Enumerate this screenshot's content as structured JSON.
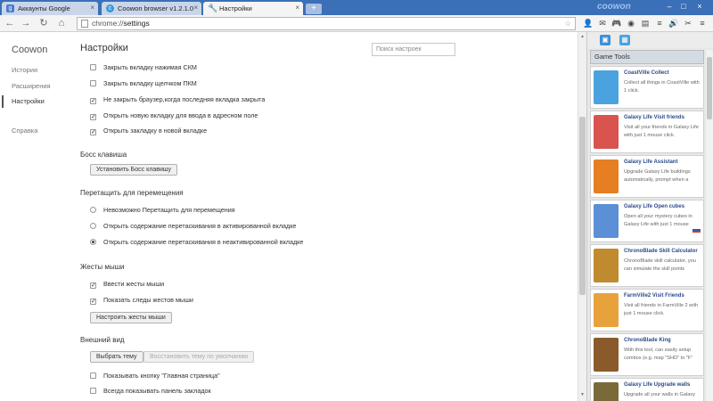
{
  "tabs": [
    {
      "label": "Аккаунты Google",
      "icon": "google-icon",
      "color": "#4a7bd0"
    },
    {
      "label": "Coowon browser v1.2.1.0",
      "icon": "coowon-icon",
      "color": "#3a9ad9"
    },
    {
      "label": "Настройки",
      "icon": "wrench-icon",
      "color": "#888888"
    }
  ],
  "brand": "coowon",
  "address": {
    "prefix": "chrome://",
    "path": "settings"
  },
  "leftnav": {
    "title": "Coowon",
    "items": [
      "История",
      "Расширения",
      "Настройки",
      "Справка"
    ],
    "selected": "Настройки"
  },
  "main": {
    "title": "Настройки",
    "search_placeholder": "Поиск настроек",
    "tab_options": [
      {
        "label": "Закрыть вкладку нажимая СКМ",
        "checked": false
      },
      {
        "label": "Закрыть вкладку щелчком ПКМ",
        "checked": false
      },
      {
        "label": "Не закрыть браузер,когда последняя вкладка закрыта",
        "checked": true
      },
      {
        "label": "Открыть новую вкладку для ввода в адресном поле",
        "checked": true
      },
      {
        "label": "Открыть закладку в новой вкладке",
        "checked": true
      }
    ],
    "boss_key": {
      "heading": "Босс клавиша",
      "button": "Установить Босс клавишу"
    },
    "drag": {
      "heading": "Перетащить для перемещения",
      "options": [
        {
          "label": "Невозможно Перетащить для перемещения",
          "selected": false
        },
        {
          "label": "Открыть содержание перетаскивания в активированной вкладке",
          "selected": false
        },
        {
          "label": "Открыть содержание перетаскивания в неактивированной вкладке",
          "selected": true
        }
      ]
    },
    "gestures": {
      "heading": "Жесты мыши",
      "options": [
        {
          "label": "Ввести жесты мыши",
          "checked": true
        },
        {
          "label": "Показать следы жестов мыши",
          "checked": true
        }
      ],
      "button": "Настроить жесты мыши"
    },
    "appearance": {
      "heading": "Внешний вид",
      "theme_button": "Выбрать тему",
      "reset_button": "Восстановить тему по умолчанию",
      "options": [
        {
          "label": "Показывать кнопку \"Главная страница\"",
          "checked": false
        },
        {
          "label": "Всегда показывать панель закладок",
          "checked": false
        }
      ]
    }
  },
  "sidepanel": {
    "header": "Game Tools",
    "cards": [
      {
        "title": "CoastVille Collect",
        "desc": "Collect all things in CoastVille with 1 click.",
        "color": "#4aa3df"
      },
      {
        "title": "Galaxy Life Visit friends",
        "desc": "Visit all your friends in Galaxy Life with just 1 mouse click.",
        "color": "#d9534f"
      },
      {
        "title": "Galaxy Life Assistant",
        "desc": "Upgrade Galaxy Life buildings automatically, prompt when a",
        "color": "#e67e22"
      },
      {
        "title": "Galaxy Life Open cubes",
        "desc": "Open all your mystery cubes in Galaxy Life with just 1 mouse",
        "color": "#5b8fd6"
      },
      {
        "title": "ChronoBlade Skill Calculator",
        "desc": "ChronoBlade skill calculator, you can simulate the skill points",
        "color": "#c08a2e"
      },
      {
        "title": "FarmVille2 Visit Friends",
        "desc": "Visit all friends in FarmVille 2 with just 1 mouse click.",
        "color": "#e8a23c"
      },
      {
        "title": "ChronoBlade King",
        "desc": "With this tool, can easily setup combos (e.g. map \"SHD\" to \"F\"",
        "color": "#8a5a2b"
      },
      {
        "title": "Galaxy Life Upgrade walls",
        "desc": "Upgrade all your walls in Galaxy",
        "color": "#7a6a3a"
      }
    ]
  }
}
